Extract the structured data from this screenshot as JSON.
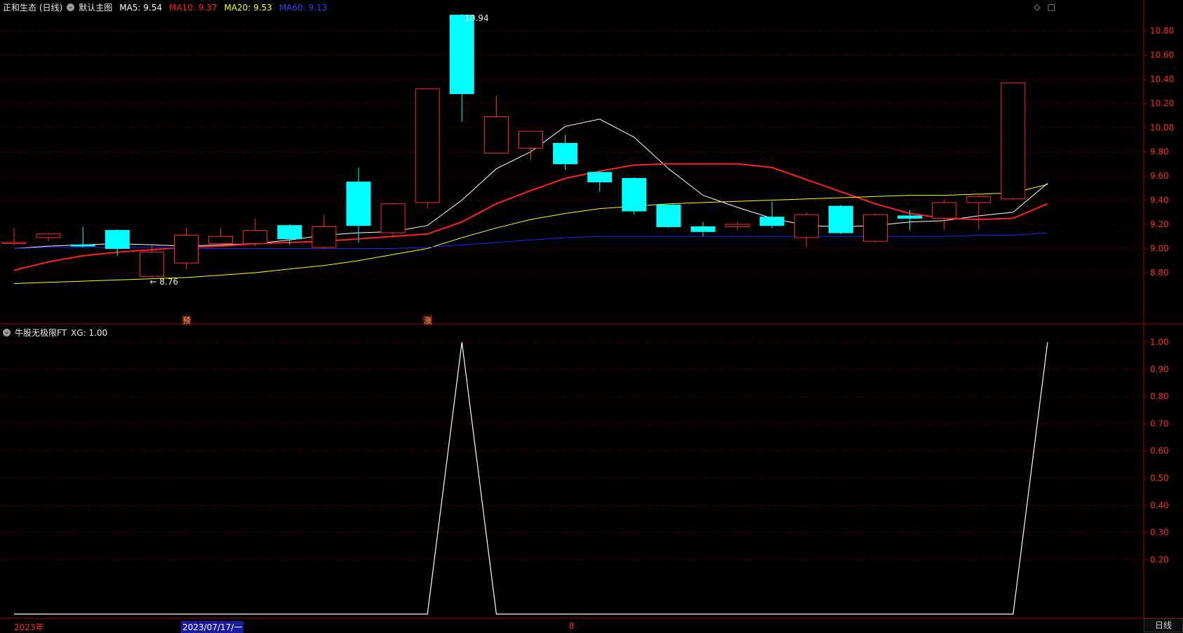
{
  "header": {
    "stock_name": "正和生态 (日线)",
    "chart_menu": "默认主图",
    "ma_items": [
      {
        "label": "MA5: 9.54",
        "color": "#ffffff"
      },
      {
        "label": "MA10: 9.37",
        "color": "#ff2020"
      },
      {
        "label": "MA20: 9.53",
        "color": "#ffff00"
      },
      {
        "label": "MA60: 9.13",
        "color": "#2020ff"
      }
    ]
  },
  "indicator_header": {
    "name": "牛股无极限FT",
    "value": "XG: 1.00"
  },
  "top_right_icons": [
    "◇",
    "□"
  ],
  "price_axis": [
    "10.80",
    "10.60",
    "10.40",
    "10.20",
    "10.00",
    "9.80",
    "9.60",
    "9.40",
    "9.20",
    "9.00",
    "8.80"
  ],
  "indicator_axis": [
    "1.00",
    "0.90",
    "0.80",
    "0.70",
    "0.60",
    "0.50",
    "0.40",
    "0.30",
    "0.20"
  ],
  "annotations": {
    "high_label": "10.94",
    "low_label": "← 8.76",
    "marker_1": "预",
    "marker_2": "涨"
  },
  "xaxis": {
    "year_label": "2023年",
    "cursor_date": "2023/07/17/一",
    "month_label": "8"
  },
  "period_tab": "日线",
  "colors": {
    "up": "#ff2a2a",
    "down": "#00ffff",
    "grid": "#5a0000",
    "axis_text": "#ff2a2a"
  },
  "chart_data": {
    "type": "candlestick",
    "ylim": [
      8.65,
      11.0
    ],
    "candles": [
      {
        "o": 9.04,
        "c": 9.05,
        "h": 9.17,
        "l": 9.03
      },
      {
        "o": 9.09,
        "c": 9.12,
        "h": 9.13,
        "l": 9.06
      },
      {
        "o": 9.03,
        "c": 9.02,
        "h": 9.18,
        "l": 9.01
      },
      {
        "o": 9.15,
        "c": 9.0,
        "h": 9.16,
        "l": 8.94
      },
      {
        "o": 8.77,
        "c": 8.97,
        "h": 9.02,
        "l": 8.76
      },
      {
        "o": 8.88,
        "c": 9.11,
        "h": 9.17,
        "l": 8.83
      },
      {
        "o": 9.04,
        "c": 9.1,
        "h": 9.17,
        "l": 9.02
      },
      {
        "o": 9.04,
        "c": 9.15,
        "h": 9.25,
        "l": 9.02
      },
      {
        "o": 9.19,
        "c": 9.08,
        "h": 9.2,
        "l": 9.03
      },
      {
        "o": 9.01,
        "c": 9.18,
        "h": 9.28,
        "l": 9.0
      },
      {
        "o": 9.55,
        "c": 9.19,
        "h": 9.67,
        "l": 9.05
      },
      {
        "o": 9.13,
        "c": 9.37,
        "h": 9.38,
        "l": 9.09
      },
      {
        "o": 9.38,
        "c": 10.32,
        "h": 10.32,
        "l": 9.33
      },
      {
        "o": 10.93,
        "c": 10.28,
        "h": 10.94,
        "l": 10.05
      },
      {
        "o": 9.79,
        "c": 10.09,
        "h": 10.26,
        "l": 9.79
      },
      {
        "o": 9.83,
        "c": 9.97,
        "h": 9.97,
        "l": 9.73
      },
      {
        "o": 9.87,
        "c": 9.7,
        "h": 9.94,
        "l": 9.65
      },
      {
        "o": 9.63,
        "c": 9.55,
        "h": 9.64,
        "l": 9.47
      },
      {
        "o": 9.58,
        "c": 9.31,
        "h": 9.59,
        "l": 9.28
      },
      {
        "o": 9.36,
        "c": 9.18,
        "h": 9.36,
        "l": 9.17
      },
      {
        "o": 9.18,
        "c": 9.14,
        "h": 9.22,
        "l": 9.1
      },
      {
        "o": 9.18,
        "c": 9.2,
        "h": 9.22,
        "l": 9.15
      },
      {
        "o": 9.26,
        "c": 9.19,
        "h": 9.39,
        "l": 9.17
      },
      {
        "o": 9.09,
        "c": 9.28,
        "h": 9.3,
        "l": 9.01
      },
      {
        "o": 9.35,
        "c": 9.13,
        "h": 9.36,
        "l": 9.12
      },
      {
        "o": 9.06,
        "c": 9.28,
        "h": 9.29,
        "l": 9.05
      },
      {
        "o": 9.27,
        "c": 9.25,
        "h": 9.32,
        "l": 9.15
      },
      {
        "o": 9.25,
        "c": 9.38,
        "h": 9.4,
        "l": 9.15
      },
      {
        "o": 9.38,
        "c": 9.43,
        "h": 9.44,
        "l": 9.16
      },
      {
        "o": 9.41,
        "c": 10.37,
        "h": 10.37,
        "l": 9.4
      }
    ],
    "ma_series": [
      {
        "name": "MA5",
        "color": "#ffffff",
        "values": [
          9.0,
          9.02,
          9.03,
          9.04,
          9.03,
          9.02,
          9.03,
          9.04,
          9.07,
          9.11,
          9.13,
          9.14,
          9.19,
          9.4,
          9.66,
          9.8,
          10.01,
          10.07,
          9.92,
          9.66,
          9.44,
          9.34,
          9.25,
          9.19,
          9.18,
          9.19,
          9.22,
          9.23,
          9.27,
          9.3,
          9.54
        ]
      },
      {
        "name": "MA10",
        "color": "#ff2020",
        "values": [
          8.82,
          8.89,
          8.94,
          8.97,
          8.99,
          9.01,
          9.02,
          9.04,
          9.05,
          9.06,
          9.08,
          9.1,
          9.12,
          9.22,
          9.37,
          9.48,
          9.58,
          9.64,
          9.69,
          9.7,
          9.7,
          9.7,
          9.67,
          9.57,
          9.47,
          9.37,
          9.29,
          9.25,
          9.24,
          9.25,
          9.37
        ]
      },
      {
        "name": "MA20",
        "color": "#ffff00",
        "values": [
          8.71,
          8.72,
          8.73,
          8.74,
          8.75,
          8.76,
          8.78,
          8.8,
          8.83,
          8.86,
          8.9,
          8.95,
          9.0,
          9.09,
          9.17,
          9.24,
          9.29,
          9.33,
          9.35,
          9.37,
          9.38,
          9.39,
          9.4,
          9.41,
          9.42,
          9.43,
          9.44,
          9.44,
          9.45,
          9.46,
          9.53
        ]
      },
      {
        "name": "MA60",
        "color": "#2020ff",
        "values": [
          9.0,
          9.01,
          9.01,
          9.01,
          9.01,
          9.0,
          9.0,
          9.0,
          9.0,
          9.0,
          9.0,
          9.0,
          9.01,
          9.03,
          9.05,
          9.07,
          9.09,
          9.1,
          9.1,
          9.1,
          9.1,
          9.1,
          9.1,
          9.1,
          9.1,
          9.1,
          9.1,
          9.1,
          9.11,
          9.11,
          9.13
        ]
      }
    ],
    "indicator": {
      "name": "XG",
      "ylim": [
        0,
        1.0
      ],
      "values": [
        0,
        0,
        0,
        0,
        0,
        0,
        0,
        0,
        0,
        0,
        0,
        0,
        0,
        1,
        0,
        0,
        0,
        0,
        0,
        0,
        0,
        0,
        0,
        0,
        0,
        0,
        0,
        0,
        0,
        0,
        1
      ],
      "color": "#ffffff"
    }
  }
}
